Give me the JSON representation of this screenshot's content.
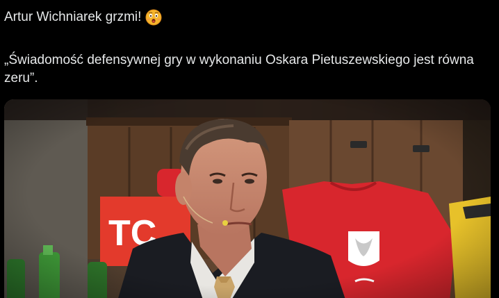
{
  "tweet": {
    "headline": "Artur Wichniarek grzmi!",
    "emoji": "astonished-face-icon",
    "quote": "„Świadomość defensywnej gry w wykonaniu Oskara Pietuszewskiego jest równa zeru”.",
    "media": {
      "banner_text": "TC"
    }
  },
  "colors": {
    "background": "#000000",
    "text": "#e7e9ea",
    "shirt_red": "#d8262d",
    "banner_red": "#e33a2c"
  }
}
